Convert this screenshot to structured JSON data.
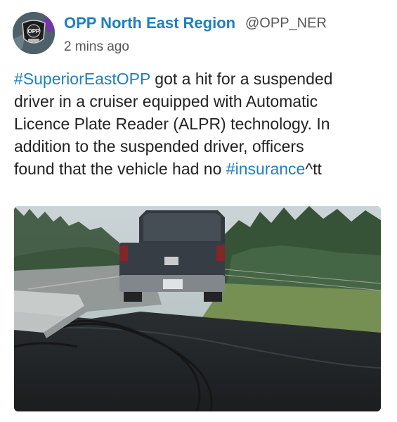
{
  "post": {
    "author_name": "OPP North East Region",
    "author_handle": "@OPP_NER",
    "timestamp": "2 mins ago",
    "avatar_text": "OPP",
    "body": {
      "hashtag1": "#SuperiorEastOPP",
      "line1_rest": " got a hit for a suspended",
      "line2": "driver in a cruiser equipped with Automatic",
      "line3": "Licence Plate Reader (ALPR) technology.  In",
      "line4": "addition to the suspended driver, officers",
      "line5_start": "found that the vehicle had no ",
      "hashtag2": "#insurance",
      "line5_end": "^tt"
    },
    "image": {
      "subject": "dark pickup truck viewed through cruiser windshield"
    }
  }
}
